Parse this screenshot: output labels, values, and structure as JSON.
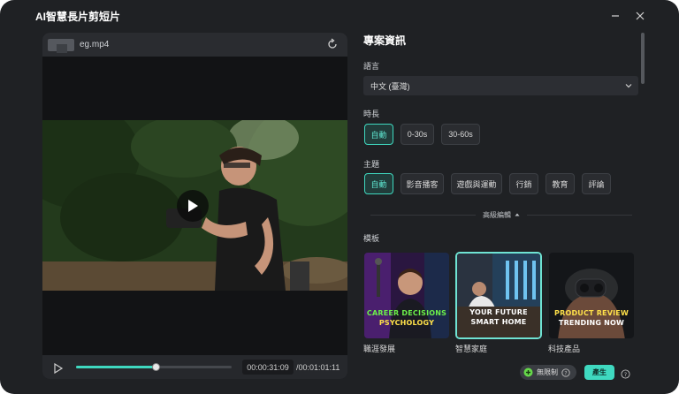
{
  "window": {
    "title": "AI智慧長片剪短片"
  },
  "preview": {
    "file_name": "eg.mp4",
    "current_time": "00:00:31:09",
    "total_time": "/00:01:01:11",
    "progress": 0.51
  },
  "settings": {
    "section_title": "專案資訊",
    "language": {
      "label": "語言",
      "value": "中文 (臺灣)"
    },
    "duration": {
      "label": "時長",
      "options": [
        "自動",
        "0-30s",
        "30-60s"
      ],
      "selected": 0
    },
    "theme": {
      "label": "主題",
      "options": [
        "自動",
        "影音播客",
        "遊戲與運動",
        "行銷",
        "教育",
        "評論"
      ],
      "selected": 0
    },
    "advanced_label": "高級編輯",
    "template": {
      "label": "模板",
      "items": [
        {
          "name": "職涯發展",
          "caption_lines": [
            "CAREER DECISIONS",
            "PSYCHOLOGY"
          ]
        },
        {
          "name": "智慧家庭",
          "caption_lines": [
            "YOUR FUTURE",
            "SMART HOME"
          ]
        },
        {
          "name": "科技產品",
          "caption_lines": [
            "PRODUCT REVIEW",
            "TRENDING NOW"
          ]
        }
      ],
      "selected": 1
    }
  },
  "footer": {
    "unlimited_label": "無限制",
    "generate_label": "產生"
  },
  "colors": {
    "accent": "#3fd9c0",
    "background": "#1f2124"
  }
}
